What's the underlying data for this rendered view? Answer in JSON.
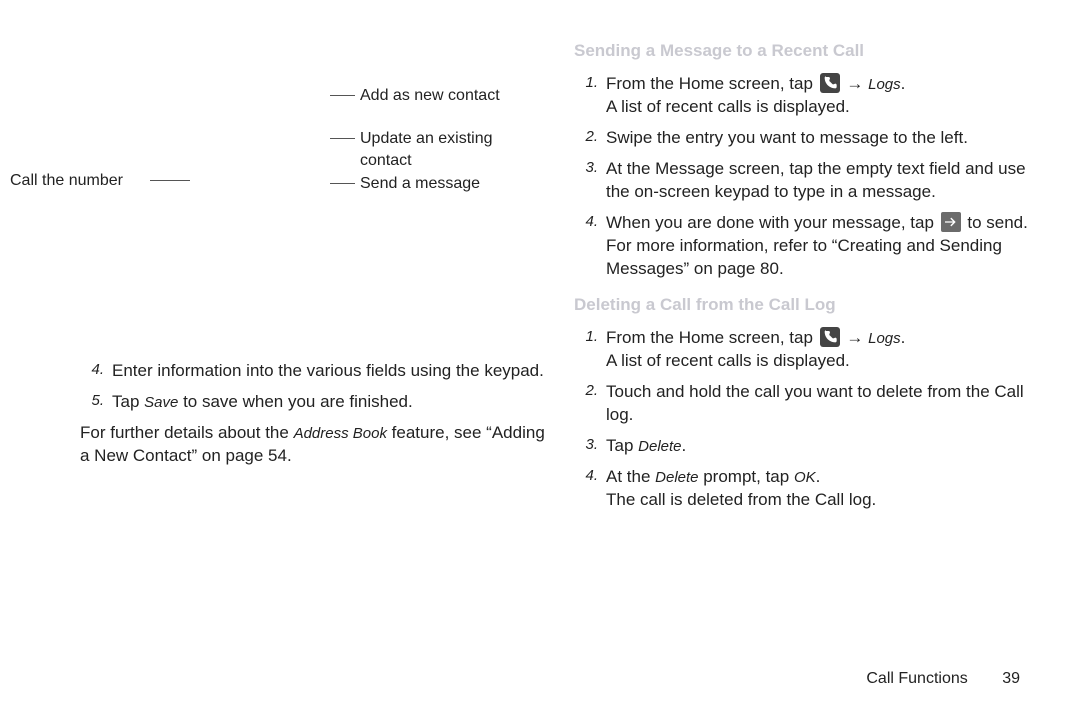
{
  "left": {
    "diagram": {
      "callTheNumber": "Call the number",
      "addAsNew": "Add as new contact",
      "updateExisting": "Update an existing contact",
      "sendMessage": "Send a message"
    },
    "steps": {
      "s4num": "4.",
      "s4": "Enter information into the various fields using the keypad.",
      "s5num": "5.",
      "s5a": "Tap ",
      "s5save": "Save",
      "s5b": " to save when you are finished."
    },
    "paraA": "For further details about the ",
    "addressBook": "Address Book",
    "paraB": " feature, see “Adding a New Contact” on page 54."
  },
  "right": {
    "h1": "Sending a Message to a Recent Call",
    "s1num": "1.",
    "s1a": "From the Home screen, tap ",
    "s1logs": "Logs",
    "s1b": ".",
    "s1c": "A list of recent calls is displayed.",
    "s2num": "2.",
    "s2": "Swipe the entry you want to message to the left.",
    "s3num": "3.",
    "s3": "At the Message screen, tap the empty text field and use the on-screen keypad to type in a message.",
    "s4num": "4.",
    "s4a": "When you are done with your message, tap ",
    "s4b": " to send.",
    "s4c": "For more information, refer to “Creating and Sending Messages” on page 80.",
    "h2": "Deleting a Call from the Call Log",
    "d1num": "1.",
    "d1a": "From the Home screen, tap ",
    "d1logs": "Logs",
    "d1b": ".",
    "d1c": "A list of recent calls is displayed.",
    "d2num": "2.",
    "d2": "Touch and hold the call you want to delete from the Call log.",
    "d3num": "3.",
    "d3a": "Tap ",
    "d3del": "Delete",
    "d3b": ".",
    "d4num": "4.",
    "d4a": "At the ",
    "d4del": "Delete",
    "d4b": " prompt, tap ",
    "d4ok": "OK",
    "d4c": ".",
    "d4d": "The call is deleted from the Call log."
  },
  "footer": {
    "section": "Call Functions",
    "page": "39"
  }
}
